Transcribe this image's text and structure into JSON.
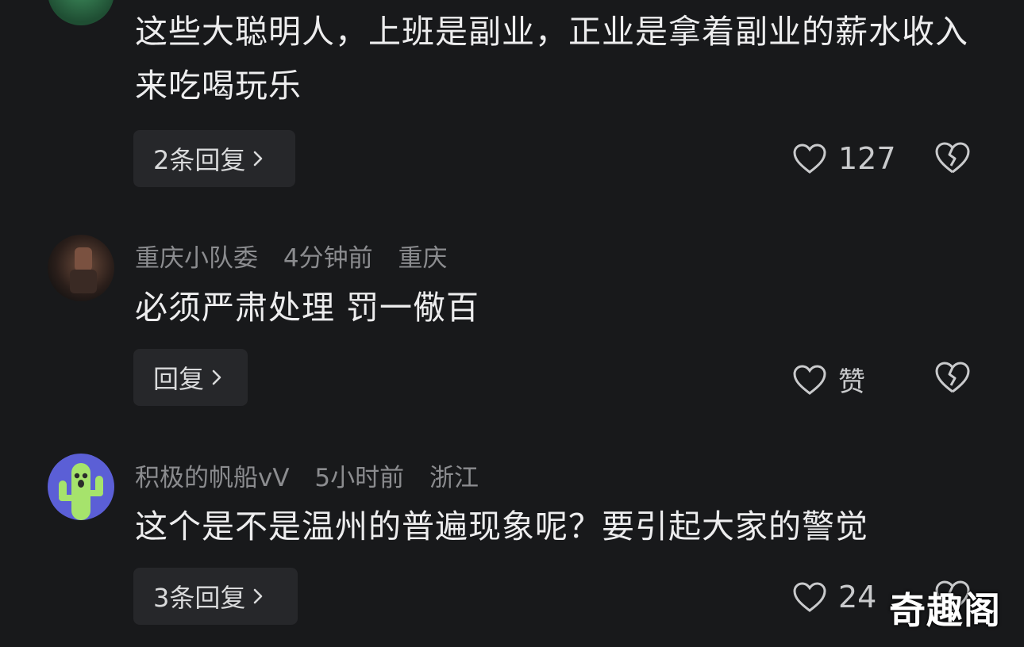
{
  "comments": [
    {
      "text": "这些大聪明人，上班是副业，正业是拿着副业的薪水收入来吃喝玩乐",
      "reply_label": "2条回复",
      "like_count": "127"
    },
    {
      "username": "重庆小队委",
      "time": "4分钟前",
      "location": "重庆",
      "text": "必须严肃处理 罚一儆百",
      "reply_label": "回复",
      "like_count": "赞"
    },
    {
      "username": "积极的帆船vV",
      "time": "5小时前",
      "location": "浙江",
      "text": "这个是不是温州的普遍现象呢？要引起大家的警觉",
      "reply_label": "3条回复",
      "like_count": "24"
    }
  ],
  "icons": {
    "like": "heart-outline-icon",
    "dislike": "broken-heart-icon",
    "reply_arrow": "chevron-right-icon"
  },
  "colors": {
    "background": "#18191b",
    "meta_text": "#8b8c8f",
    "button_bg": "#26272a",
    "avatar3": "#5b5fd6",
    "cactus": "#a6e36c"
  },
  "watermark": "奇趣阁"
}
